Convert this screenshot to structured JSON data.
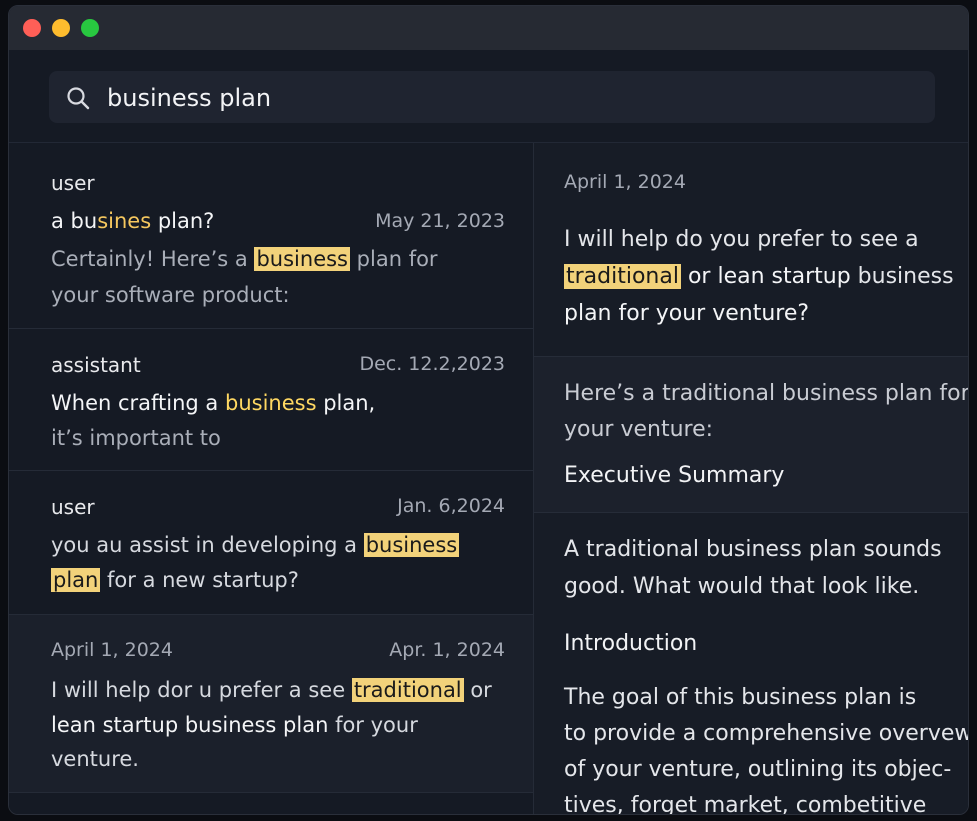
{
  "window": {
    "title": ""
  },
  "search": {
    "value": "business plan",
    "icon": "search-icon"
  },
  "results": [
    {
      "role": "user",
      "title_pre": "a bu",
      "title_hl": "sines",
      "title_post": " plan?",
      "date": "May 21, 2023",
      "line1_pre": "Certainly!  Here’s  a ",
      "line1_hl": "business",
      "line1_post": " plan  for",
      "line2": "your software product:"
    },
    {
      "role": "assistant",
      "date": "Dec. 12.2,2023",
      "line1_pre": "When crafting a ",
      "line1_hl": "business",
      "line1_post": " plan,",
      "line2": "it’s important to"
    },
    {
      "role": "user",
      "date": "Jan. 6,2024",
      "line1_pre": "you  au assist in developing a ",
      "line1_hl": "business",
      "line2_hl": "plan",
      "line2_post": " for a new startup?"
    },
    {
      "date_left": "April 1, 2024",
      "date": "Apr. 1, 2024",
      "line1_pre": "I will help dor u prefer a see ",
      "line1_hl": "traditional",
      "line1_post": " or",
      "line2_strong": "lean startup business plan",
      "line2_post": " for your",
      "line3": "venture."
    }
  ],
  "detail": {
    "date": "April 1, 2024",
    "msg1_line1": "I will help do you prefer to see a",
    "msg1_line2_hl": "traditional",
    "msg1_line2_post_strong": " or lean startup",
    "msg1_line2_tail": " business",
    "msg1_line3": "plan for your venture?",
    "msg2_line1": "Here’s a traditional business plan for",
    "msg2_line2": "your venture:",
    "msg2_heading": "Executive Summary",
    "msg3_line1": "A traditional business plan sounds",
    "msg3_line2": "good. What would that look like.",
    "msg3_heading": "Introduction",
    "msg3_p1": "The goal of this business plan is",
    "msg3_p2": "to provide a comprehensive overvew",
    "msg3_p3": "of your venture, outlining its objec-",
    "msg3_p4": "tives, forget market, combetitive"
  }
}
